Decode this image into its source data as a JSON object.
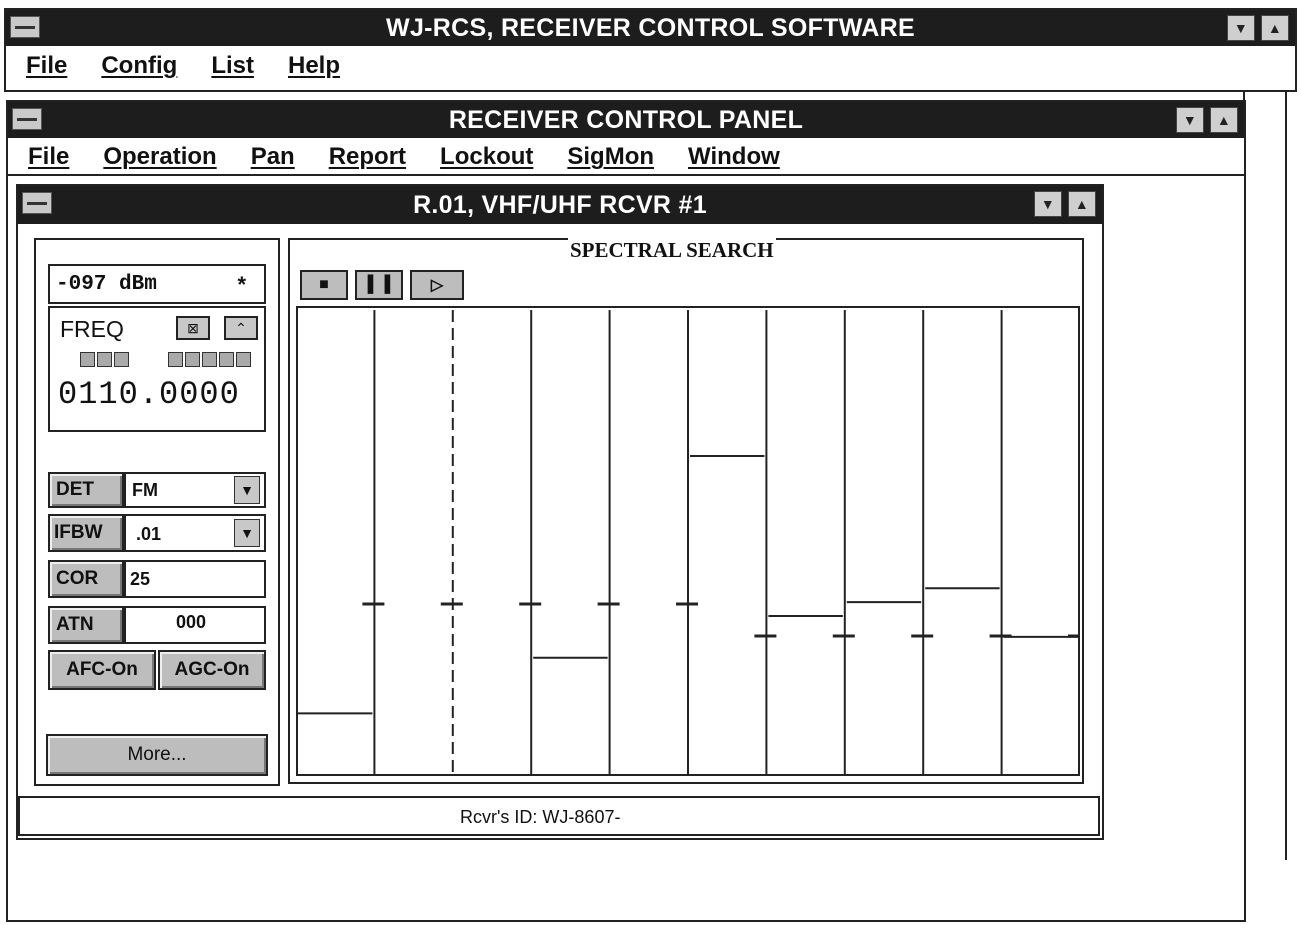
{
  "app_window": {
    "title": "WJ-RCS, RECEIVER CONTROL SOFTWARE",
    "menu": [
      "File",
      "Config",
      "List",
      "Help"
    ]
  },
  "control_panel": {
    "title": "RECEIVER CONTROL PANEL",
    "menu": [
      "File",
      "Operation",
      "Pan",
      "Report",
      "Lockout",
      "SigMon",
      "Window"
    ]
  },
  "receiver_window": {
    "title": "R.01, VHF/UHF RCVR #1",
    "signal_level": "-097 dBm",
    "signal_marker": "*",
    "freq_label": "FREQ",
    "frequency": "0110.0000",
    "det_label": "DET",
    "det_value": "FM",
    "ifbw_label": "IFBW",
    "ifbw_value": ".01",
    "cor_label": "COR",
    "cor_value": "25",
    "atn_label": "ATN",
    "atn_value": "000",
    "afc_label": "AFC-On",
    "agc_label": "AGC-On",
    "more_label": "More...",
    "status": "Rcvr's ID: WJ-8607-"
  },
  "spectral_search": {
    "title": "SPECTRAL SEARCH",
    "toolbar": [
      "stop-icon",
      "pause-icon",
      "scan-forward-icon"
    ],
    "channels": 9,
    "selected_channel": 2,
    "levels": [
      0.09,
      0.0,
      0.0,
      0.17,
      0.0,
      0.46,
      0.23,
      0.25,
      0.27,
      0.2
    ]
  },
  "colors": {
    "titlebar": "#1d1d1d",
    "button_gray": "#bdbdbd",
    "border": "#222222"
  }
}
